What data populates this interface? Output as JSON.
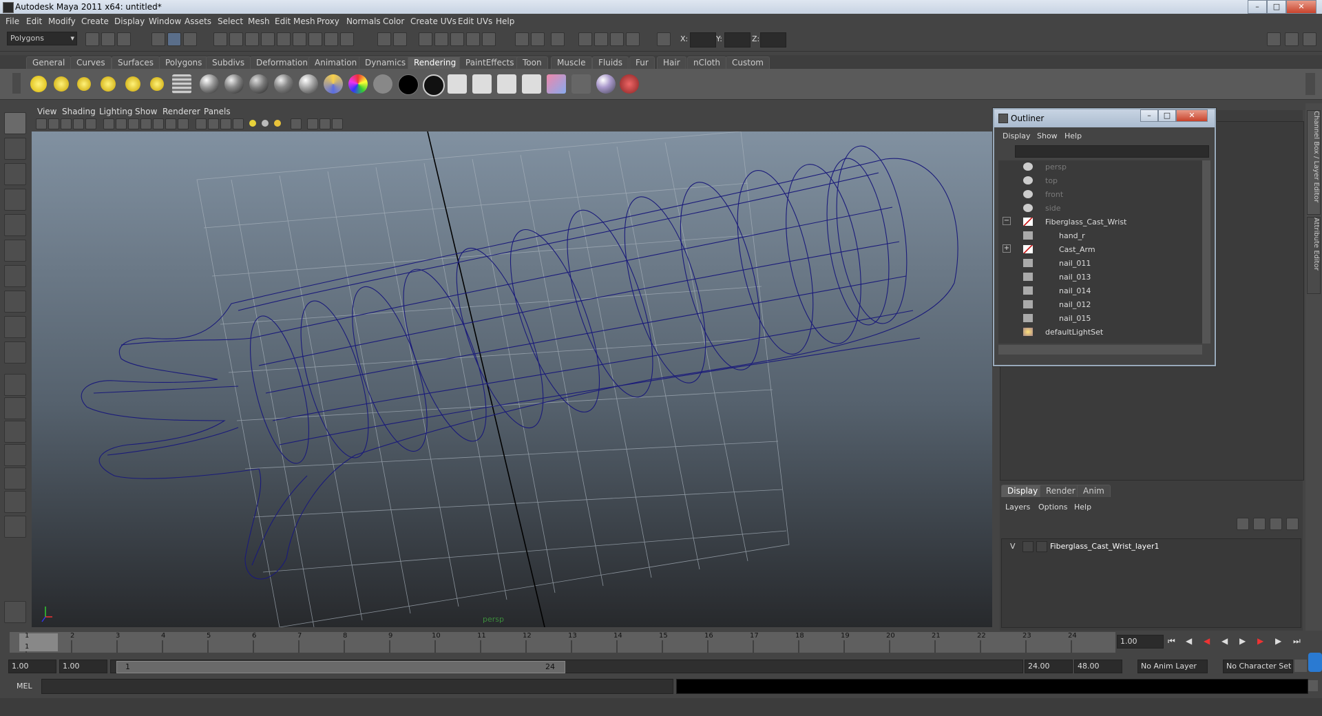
{
  "window": {
    "title": "Autodesk Maya 2011 x64: untitled*"
  },
  "menubar": [
    "File",
    "Edit",
    "Modify",
    "Create",
    "Display",
    "Window",
    "Assets",
    "Select",
    "Mesh",
    "Edit Mesh",
    "Proxy",
    "Normals",
    "Color",
    "Create UVs",
    "Edit UVs",
    "Help"
  ],
  "statusline": {
    "mode": "Polygons",
    "x_label": "X:",
    "y_label": "Y:",
    "z_label": "Z:"
  },
  "shelf_tabs": [
    "General",
    "Curves",
    "Surfaces",
    "Polygons",
    "Subdivs",
    "Deformation",
    "Animation",
    "Dynamics",
    "Rendering",
    "PaintEffects",
    "Toon",
    "Muscle",
    "Fluids",
    "Fur",
    "Hair",
    "nCloth",
    "Custom"
  ],
  "active_shelf_tab": "Rendering",
  "viewport": {
    "menu": [
      "View",
      "Shading",
      "Lighting",
      "Show",
      "Renderer",
      "Panels"
    ],
    "camera_label": "persp"
  },
  "outliner": {
    "title": "Outliner",
    "menu": [
      "Display",
      "Show",
      "Help"
    ],
    "items": [
      {
        "label": "persp",
        "dim": true
      },
      {
        "label": "top",
        "dim": true
      },
      {
        "label": "front",
        "dim": true
      },
      {
        "label": "side",
        "dim": true
      },
      {
        "label": "Fiberglass_Cast_Wrist",
        "expander": "−"
      },
      {
        "label": "hand_r"
      },
      {
        "label": "Cast_Arm",
        "expander": "+"
      },
      {
        "label": "nail_011"
      },
      {
        "label": "nail_013"
      },
      {
        "label": "nail_014"
      },
      {
        "label": "nail_012"
      },
      {
        "label": "nail_015"
      },
      {
        "label": "defaultLightSet"
      }
    ]
  },
  "layer_editor": {
    "tabs": [
      "Display",
      "Render",
      "Anim"
    ],
    "menu": [
      "Layers",
      "Options",
      "Help"
    ],
    "layer": {
      "visibility": "V",
      "name": "Fiberglass_Cast_Wrist_layer1"
    }
  },
  "side_tabs": [
    "Channel Box / Layer Editor",
    "Attribute Editor"
  ],
  "timeline": {
    "ticks": [
      "1",
      "2",
      "3",
      "4",
      "5",
      "6",
      "7",
      "8",
      "9",
      "10",
      "11",
      "12",
      "13",
      "14",
      "15",
      "16",
      "17",
      "18",
      "19",
      "20",
      "21",
      "22",
      "23",
      "24"
    ],
    "current_frame": "1",
    "current_field": "1.00"
  },
  "range": {
    "start": "1.00",
    "anim_start": "1.00",
    "slider_start": "1",
    "slider_end": "24",
    "end": "24.00",
    "anim_end": "48.00",
    "anim_layer": "No Anim Layer",
    "character_set": "No Character Set"
  },
  "command_line": {
    "label": "MEL"
  },
  "colors": {
    "wireframe": "#1a1a7a",
    "accent": "#5c5c5c"
  }
}
